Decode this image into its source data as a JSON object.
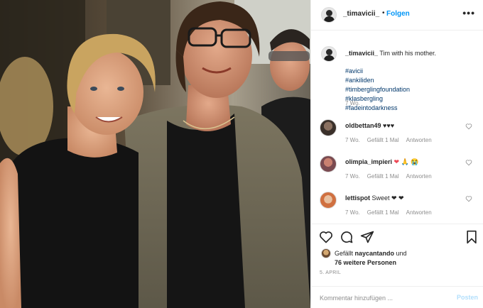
{
  "post": {
    "username": "_timavicii_",
    "dot": "•",
    "follow_label": "Folgen",
    "more_icon": "•••"
  },
  "caption": {
    "username": "_timavicii_",
    "text": " Tim with his mother.",
    "hashtags": [
      "#avicii",
      "#ankiliden",
      "#timberglingfoundation",
      "#klasbergling",
      "#fadeintodarkness"
    ],
    "age": "7 Wo."
  },
  "comments": [
    {
      "username": "oldbettan49",
      "text": " ♥♥♥",
      "age": "7 Wo.",
      "likes": "Gefällt 1 Mal",
      "reply": "Antworten"
    },
    {
      "username": "olimpia_impieri",
      "text": " ❤ 🙏 😭",
      "age": "7 Wo.",
      "likes": "Gefällt 1 Mal",
      "reply": "Antworten"
    },
    {
      "username": "lettispot",
      "text": " Sweet ❤ ❤",
      "age": "7 Wo.",
      "likes": "Gefällt 1 Mal",
      "reply": "Antworten"
    }
  ],
  "likes": {
    "prefix": "Gefällt ",
    "user": "naycantando",
    "mid": " und ",
    "others": "76 weitere Personen"
  },
  "date": "5. APRIL",
  "comment_input": {
    "placeholder": "Kommentar hinzufügen ...",
    "post_label": "Posten"
  },
  "colors": {
    "link": "#0095f6",
    "hashtag": "#00376b",
    "muted": "#8e8e8e",
    "post_disabled": "#b2dffc",
    "heart_red": "#ed4956"
  },
  "icons": {
    "more": "more-options-icon",
    "like": "heart-icon",
    "comment": "comment-icon",
    "share": "paper-plane-icon",
    "save": "bookmark-icon",
    "comment_like": "small-heart-icon"
  }
}
